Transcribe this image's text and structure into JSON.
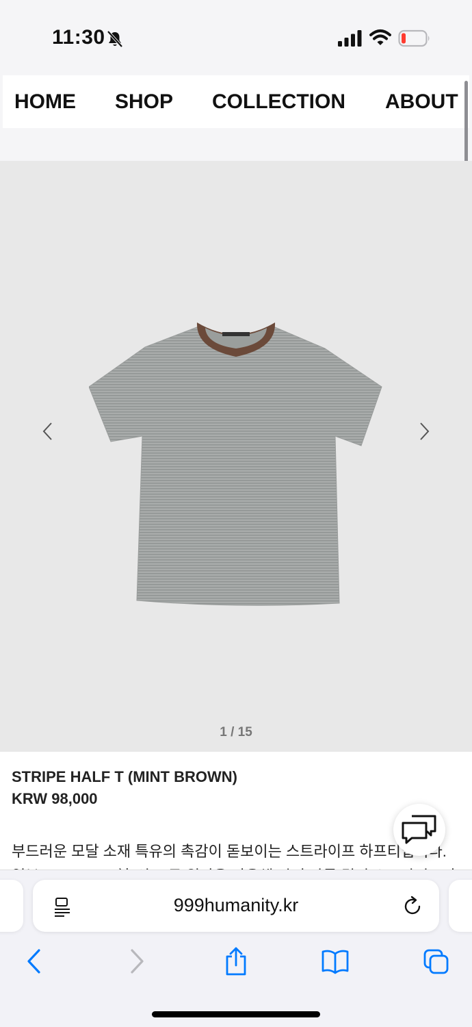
{
  "status_bar": {
    "time": "11:30"
  },
  "nav": {
    "items": [
      "HOME",
      "SHOP",
      "COLLECTION",
      "ABOUT"
    ]
  },
  "gallery": {
    "counter": "1 / 15"
  },
  "product": {
    "name": "STRIPE HALF T (MINT BROWN)",
    "price": "KRW 98,000",
    "description_line1": "부드러운 모달 소재 특유의 촉감이 돋보이는 스트라이프 하프티입니다.",
    "description_line2": "일본 TAKISADA社 의 고급 원단을 사용해 각기 다른 컬러 스트라이프가"
  },
  "browser": {
    "url": "999humanity.kr"
  },
  "colors": {
    "accent": "#007aff",
    "battery_low": "#ff3b30",
    "collar": "#6b4a3a"
  }
}
